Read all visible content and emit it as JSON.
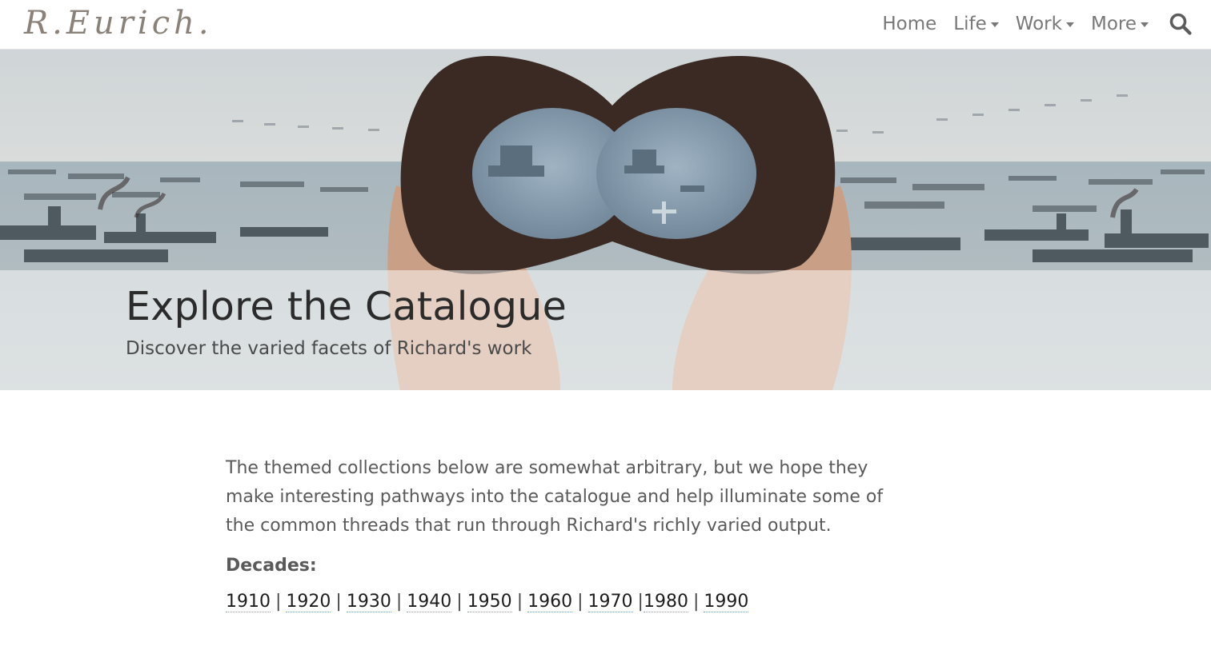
{
  "brand": {
    "name": "R.Eurich."
  },
  "nav": {
    "items": [
      {
        "label": "Home",
        "dropdown": false
      },
      {
        "label": "Life",
        "dropdown": true
      },
      {
        "label": "Work",
        "dropdown": true
      },
      {
        "label": "More",
        "dropdown": true
      }
    ],
    "search_icon": "search-icon"
  },
  "hero": {
    "title": "Explore the Catalogue",
    "subtitle": "Discover the varied facets of Richard's work"
  },
  "content": {
    "intro": "The themed collections below are somewhat arbitrary, but we hope they make interesting pathways into the catalogue and help illuminate some of the common threads that run through Richard's richly varied output.",
    "decades_label": "Decades:",
    "decades": [
      "1910",
      "1920",
      "1930",
      "1940",
      "1950",
      "1960",
      "1970",
      "1980",
      "1990"
    ],
    "separator": "|"
  },
  "colors": {
    "brand": "#8a8178",
    "nav_text": "#787878",
    "body_text": "#5a5a5a",
    "link_underline": "#7aa0c8"
  }
}
